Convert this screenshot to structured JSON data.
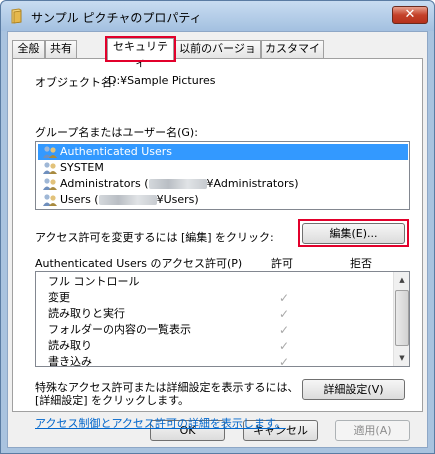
{
  "window": {
    "title": "サンプル ピクチャのプロパティ",
    "close_label": "✕"
  },
  "tabs": [
    {
      "label": "全般"
    },
    {
      "label": "共有"
    },
    {
      "label": "セキュリティ"
    },
    {
      "label": "以前のバージョン"
    },
    {
      "label": "カスタマイズ"
    }
  ],
  "security": {
    "object_name_label": "オブジェクト名:",
    "object_name_value": "D:¥Sample Pictures",
    "group_label": "グループ名またはユーザー名(G):",
    "users": [
      {
        "name": "Authenticated Users"
      },
      {
        "name": "SYSTEM"
      },
      {
        "prefix": "Administrators (",
        "suffix": "¥Administrators)"
      },
      {
        "prefix": "Users (",
        "suffix": "¥Users)"
      }
    ],
    "change_text": "アクセス許可を変更するには [編集] をクリック:",
    "edit_button": "編集(E)...",
    "perm_header": "Authenticated Users のアクセス許可(P)",
    "allow_header": "許可",
    "deny_header": "拒否",
    "permissions": [
      {
        "name": "フル コントロール",
        "allow": false
      },
      {
        "name": "変更",
        "allow": true
      },
      {
        "name": "読み取りと実行",
        "allow": true
      },
      {
        "name": "フォルダーの内容の一覧表示",
        "allow": true
      },
      {
        "name": "読み取り",
        "allow": true
      },
      {
        "name": "書き込み",
        "allow": true
      }
    ],
    "advanced_text_1": "特殊なアクセス許可または詳細設定を表示するには、",
    "advanced_text_2": "[詳細設定] をクリックします。",
    "advanced_button": "詳細設定(V)",
    "link": "アクセス制御とアクセス許可の詳細を表示します。"
  },
  "footer": {
    "ok": "OK",
    "cancel": "キャンセル",
    "apply": "適用(A)"
  }
}
